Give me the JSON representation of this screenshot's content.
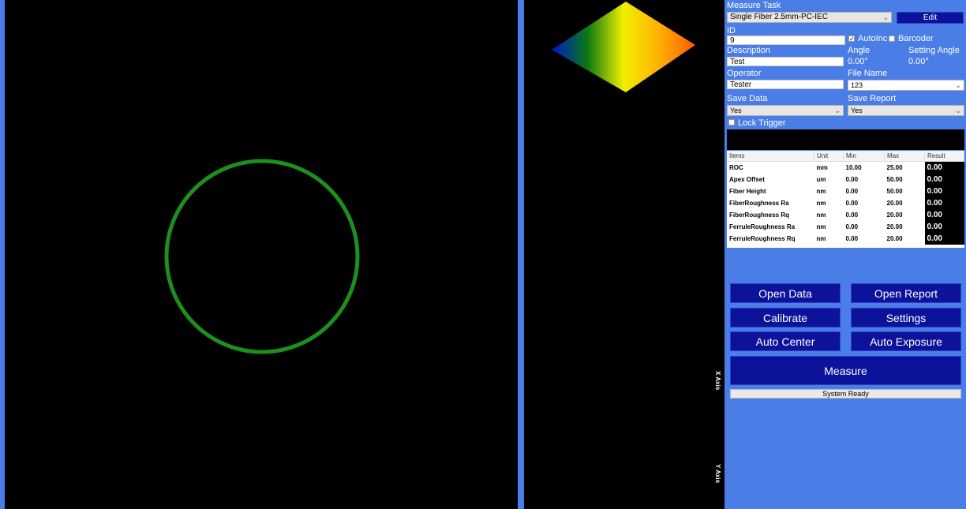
{
  "colors": {
    "panel_bg": "#4a7ee6",
    "button_bg": "#0c129a",
    "circle": "#1d8f1d"
  },
  "views": {
    "x_axis_label": "X Axis",
    "y_axis_label": "Y Axis"
  },
  "measure_task": {
    "label": "Measure Task",
    "value": "Single Fiber 2.5mm-PC-IEC",
    "edit_label": "Edit"
  },
  "id": {
    "label": "ID",
    "value": "9"
  },
  "autoinc": {
    "label": "AutoInc",
    "checked": true
  },
  "barcoder": {
    "label": "Barcoder",
    "checked": false
  },
  "angle": {
    "label": "Angle",
    "value": "0.00°"
  },
  "setting_angle": {
    "label": "Setting Angle",
    "value": "0.00°"
  },
  "description": {
    "label": "Description",
    "value": "Test"
  },
  "operator": {
    "label": "Operator",
    "value": "Tester"
  },
  "file_name": {
    "label": "File Name",
    "value": "123"
  },
  "save_data": {
    "label": "Save Data",
    "value": "Yes"
  },
  "save_report": {
    "label": "Save Report",
    "value": "Yes"
  },
  "lock_trigger": {
    "label": "Lock Trigger",
    "checked": false
  },
  "table": {
    "headers": [
      "Items",
      "Unit",
      "Min",
      "Max",
      "Result"
    ],
    "rows": [
      {
        "item": "ROC",
        "unit": "mm",
        "min": "10.00",
        "max": "25.00",
        "result": "0.00"
      },
      {
        "item": "Apex Offset",
        "unit": "um",
        "min": "0.00",
        "max": "50.00",
        "result": "0.00"
      },
      {
        "item": "Fiber Height",
        "unit": "nm",
        "min": "0.00",
        "max": "50.00",
        "result": "0.00"
      },
      {
        "item": "FiberRoughness Ra",
        "unit": "nm",
        "min": "0.00",
        "max": "20.00",
        "result": "0.00"
      },
      {
        "item": "FiberRoughness Rq",
        "unit": "nm",
        "min": "0.00",
        "max": "20.00",
        "result": "0.00"
      },
      {
        "item": "FerruleRoughness Ra",
        "unit": "nm",
        "min": "0.00",
        "max": "20.00",
        "result": "0.00"
      },
      {
        "item": "FerruleRoughness Rq",
        "unit": "nm",
        "min": "0.00",
        "max": "20.00",
        "result": "0.00"
      }
    ]
  },
  "buttons": {
    "open_data": "Open Data",
    "open_report": "Open Report",
    "calibrate": "Calibrate",
    "settings": "Settings",
    "auto_center": "Auto Center",
    "auto_exposure": "Auto Exposure",
    "measure": "Measure"
  },
  "status": "System Ready"
}
